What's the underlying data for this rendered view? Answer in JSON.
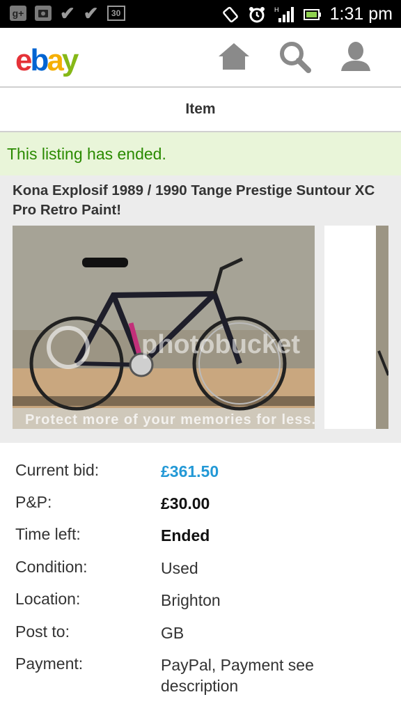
{
  "status_bar": {
    "time": "1:31 pm",
    "left_icons": [
      "google-plus-icon",
      "photo-icon",
      "check-icon",
      "check-icon",
      "calendar-icon"
    ],
    "calendar_day": "30",
    "right_icons": [
      "rotate-icon",
      "alarm-icon",
      "signal-icon",
      "battery-icon"
    ]
  },
  "header": {
    "logo_letters": [
      "e",
      "b",
      "a",
      "y"
    ],
    "logo_colors": [
      "#e53238",
      "#0064d2",
      "#f5af02",
      "#86b817"
    ],
    "icons": [
      "home-icon",
      "search-icon",
      "user-icon"
    ]
  },
  "page": {
    "subheading": "Item",
    "ended_banner": "This listing has ended."
  },
  "listing": {
    "title": "Kona Explosif 1989 / 1990 Tange Prestige Suntour XC Pro Retro Paint!",
    "photo_watermark": "Protect more of your memories for less."
  },
  "details": [
    {
      "label": "Current bid:",
      "value": "£361.50",
      "style": "blue"
    },
    {
      "label": "P&P:",
      "value": "£30.00",
      "style": "bold"
    },
    {
      "label": "Time left:",
      "value": "Ended",
      "style": "bold"
    },
    {
      "label": "Condition:",
      "value": "Used",
      "style": "plain"
    },
    {
      "label": "Location:",
      "value": "Brighton",
      "style": "plain"
    },
    {
      "label": "Post to:",
      "value": "GB",
      "style": "plain"
    },
    {
      "label": "Payment:",
      "value": "PayPal, Payment see description",
      "style": "plain"
    }
  ],
  "colors": {
    "banner_bg": "#e9f5d9",
    "banner_text": "#2a8a00",
    "price": "#2399d6"
  }
}
